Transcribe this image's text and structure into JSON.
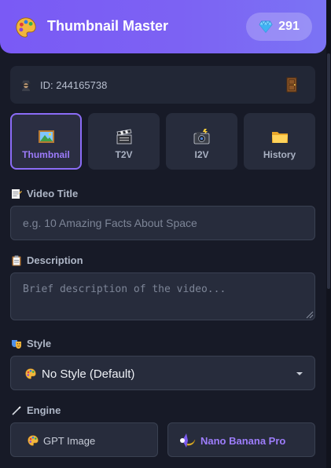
{
  "header": {
    "title": "Thumbnail Master",
    "logo_icon": "artist-palette-icon",
    "credits": {
      "icon": "gem-icon",
      "value": "291"
    }
  },
  "account": {
    "agent_icon": "detective-icon",
    "id_label": "ID: 244165738",
    "logout_icon": "door-icon"
  },
  "tabs": [
    {
      "label": "Thumbnail",
      "icon": "framed-picture-icon",
      "active": true
    },
    {
      "label": "T2V",
      "icon": "clapper-board-icon",
      "active": false
    },
    {
      "label": "I2V",
      "icon": "camera-flash-icon",
      "active": false
    },
    {
      "label": "History",
      "icon": "folder-icon",
      "active": false
    }
  ],
  "form": {
    "video_title": {
      "label": "Video Title",
      "icon": "memo-icon",
      "placeholder": "e.g. 10 Amazing Facts About Space",
      "value": ""
    },
    "description": {
      "label": "Description",
      "icon": "clipboard-icon",
      "placeholder": "Brief description of the video...",
      "value": ""
    },
    "style": {
      "label": "Style",
      "icon": "theater-masks-icon",
      "selected": "No Style (Default)",
      "selected_icon": "artist-palette-icon"
    },
    "engine": {
      "label": "Engine",
      "icon": "magic-wand-icon",
      "options": [
        {
          "label": "GPT Image",
          "icon": "artist-palette-icon",
          "selected": false
        },
        {
          "label": "Nano Banana Pro",
          "icon": "banana-icon",
          "selected": true
        }
      ]
    }
  },
  "colors": {
    "accent": "#8b6cf6",
    "header_start": "#7a5af5",
    "header_end": "#7b73f4",
    "background": "#171a27",
    "card": "#272c3c"
  }
}
